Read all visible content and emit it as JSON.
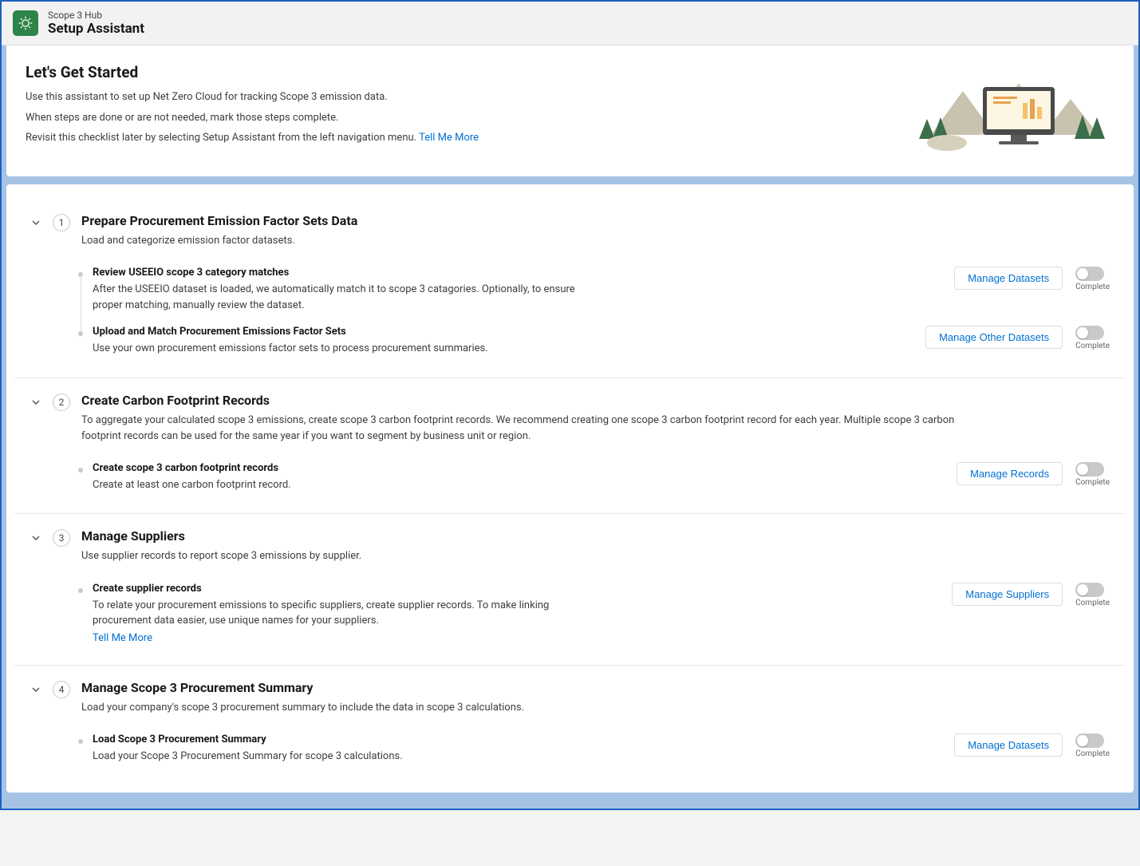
{
  "header": {
    "subtitle": "Scope 3 Hub",
    "title": "Setup Assistant"
  },
  "intro": {
    "heading": "Let's Get Started",
    "line1": "Use this assistant to set up Net Zero Cloud for tracking Scope 3 emission data.",
    "line2": "When steps are done or are not needed, mark those steps complete.",
    "line3_prefix": "Revisit this checklist later by selecting Setup Assistant from the left navigation menu. ",
    "tell_me_more": "Tell Me More"
  },
  "toggle_label": "Complete",
  "steps": [
    {
      "num": "1",
      "title": "Prepare Procurement Emission Factor Sets Data",
      "desc": "Load and categorize emission factor datasets.",
      "substeps": [
        {
          "title": "Review USEEIO scope 3 category matches",
          "desc": "After the USEEIO dataset is loaded, we automatically match it to scope 3 catagories. Optionally, to ensure proper matching, manually review the dataset.",
          "button": "Manage Datasets"
        },
        {
          "title": "Upload and Match Procurement Emissions Factor Sets",
          "desc": "Use your own procurement emissions factor sets to process procurement summaries.",
          "button": "Manage Other Datasets"
        }
      ]
    },
    {
      "num": "2",
      "title": "Create Carbon Footprint Records",
      "desc": "To aggregate your calculated scope 3 emissions, create scope 3 carbon footprint records. We recommend creating one scope 3 carbon footprint record for each year. Multiple scope 3 carbon footprint records can be used for the same year if you want to segment by business unit or region.",
      "substeps": [
        {
          "title": "Create scope 3 carbon footprint records",
          "desc": "Create at least one carbon footprint record.",
          "button": "Manage Records"
        }
      ]
    },
    {
      "num": "3",
      "title": "Manage Suppliers",
      "desc": "Use supplier records to report scope 3 emissions by supplier.",
      "substeps": [
        {
          "title": "Create supplier records",
          "desc": "To relate your procurement emissions to specific suppliers, create supplier records. To make linking procurement data easier, use unique names for your suppliers.",
          "button": "Manage Suppliers",
          "link": "Tell Me More"
        }
      ]
    },
    {
      "num": "4",
      "title": "Manage Scope 3 Procurement Summary",
      "desc": "Load your company's scope 3 procurement summary to include the data in scope 3 calculations.",
      "substeps": [
        {
          "title": "Load Scope 3 Procurement Summary",
          "desc": "Load your Scope 3 Procurement Summary for scope 3 calculations.",
          "button": "Manage Datasets"
        }
      ]
    }
  ]
}
